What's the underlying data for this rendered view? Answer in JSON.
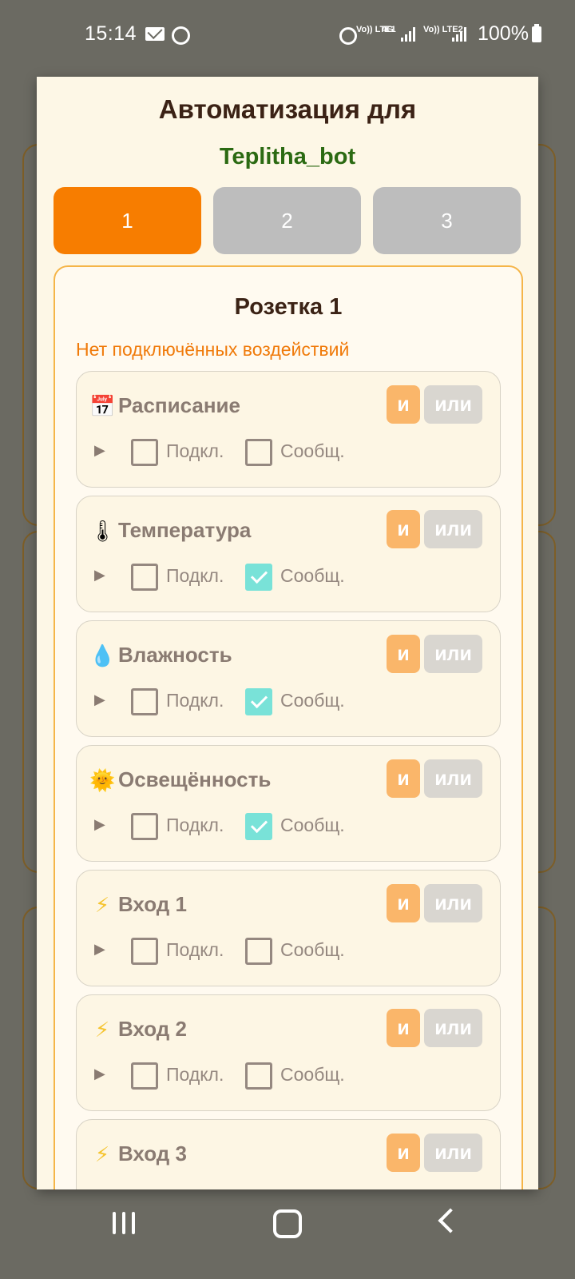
{
  "status_bar": {
    "time": "15:14",
    "lte1": "Vo)) LTE1",
    "net": "4G",
    "lte2": "Vo)) LTE2",
    "battery": "100%"
  },
  "modal": {
    "title": "Автоматизация для",
    "bot_name": "Teplitha_bot",
    "tabs": [
      "1",
      "2",
      "3"
    ],
    "active_tab": 0
  },
  "panel": {
    "title": "Розетка 1",
    "note": "Нет подключённых воздействий",
    "and_label": "и",
    "or_label": "или",
    "connect_label": "Подкл.",
    "notify_label": "Сообщ.",
    "items": [
      {
        "name": "Расписание",
        "icon": "calendar-icon",
        "connected": false,
        "notify": false
      },
      {
        "name": "Температура",
        "icon": "thermometer-icon",
        "connected": false,
        "notify": true
      },
      {
        "name": "Влажность",
        "icon": "droplet-icon",
        "connected": false,
        "notify": true
      },
      {
        "name": "Освещённость",
        "icon": "sun-icon",
        "connected": false,
        "notify": true
      },
      {
        "name": "Вход 1",
        "icon": "lightning-icon",
        "connected": false,
        "notify": false
      },
      {
        "name": "Вход 2",
        "icon": "lightning-icon",
        "connected": false,
        "notify": false
      },
      {
        "name": "Вход 3",
        "icon": "lightning-icon",
        "connected": false,
        "notify": false
      }
    ]
  },
  "colors": {
    "accent": "#f77d00",
    "bot_name": "#2b6a12",
    "checkbox_checked": "#79e2d8"
  }
}
